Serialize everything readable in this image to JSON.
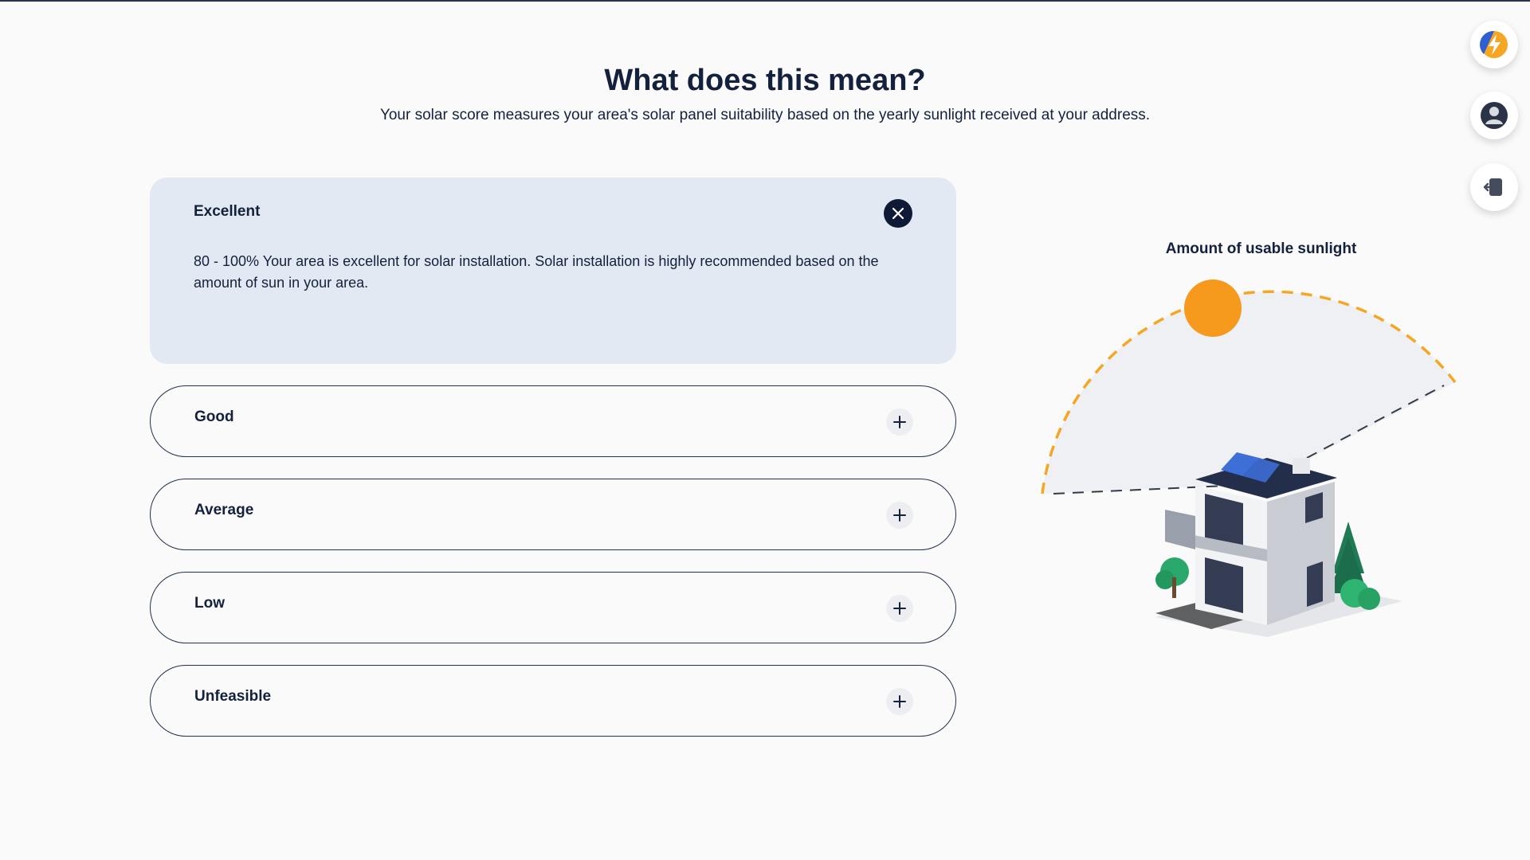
{
  "header": {
    "title": "What does this mean?",
    "subtitle": "Your solar score measures your area's solar panel suitability based on the yearly sunlight received at your address."
  },
  "accordion": {
    "items": [
      {
        "label": "Excellent",
        "expanded": true,
        "description": "80 - 100% Your area is excellent for solar installation. Solar installation is highly recommended based on the amount of sun in your area."
      },
      {
        "label": "Good",
        "expanded": false
      },
      {
        "label": "Average",
        "expanded": false
      },
      {
        "label": "Low",
        "expanded": false
      },
      {
        "label": "Unfeasible",
        "expanded": false
      }
    ]
  },
  "illustration": {
    "title": "Amount of usable sunlight"
  },
  "side_buttons": {
    "icons": [
      "bolt-logo-icon",
      "user-icon",
      "logout-icon"
    ]
  },
  "colors": {
    "navy": "#14213d",
    "sun": "#f59a1c",
    "panel_bg": "#e2e9f3"
  }
}
